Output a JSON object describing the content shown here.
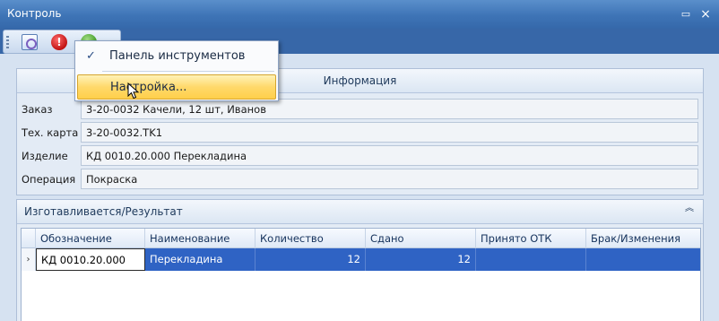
{
  "window": {
    "title": "Контроль",
    "min_glyph": "▭",
    "close_glyph": "×"
  },
  "toolbar": {
    "tools": [
      {
        "icon": "settings-icon"
      },
      {
        "icon": "stop-icon",
        "glyph": "!"
      },
      {
        "icon": "refresh-icon"
      }
    ]
  },
  "menu": {
    "items": [
      {
        "label": "Панель инструментов",
        "checked": true,
        "check_glyph": "✓"
      },
      {
        "label": "Настройка...",
        "highlighted": true
      }
    ]
  },
  "info": {
    "title": "Информация",
    "fields": [
      {
        "label": "Заказ",
        "value": "3-20-0032 Качели, 12 шт, Иванов"
      },
      {
        "label": "Тех. карта",
        "value": "3-20-0032.TK1"
      },
      {
        "label": "Изделие",
        "value": "КД 0010.20.000 Перекладина"
      },
      {
        "label": "Операция",
        "value": "Покраска"
      }
    ]
  },
  "results": {
    "title": "Изготавливается/Результат",
    "collapse_glyph": "︽",
    "columns": [
      "Обозначение",
      "Наименование",
      "Количество",
      "Сдано",
      "Принято ОТК",
      "Брак/Изменения"
    ],
    "rows": [
      {
        "indicator": "›",
        "cells": [
          "КД 0010.20.000",
          "Перекладина",
          "12",
          "12",
          "",
          ""
        ]
      }
    ]
  },
  "colors": {
    "title_bar": "#3e74b6",
    "selection": "#2f63c4",
    "menu_highlight": "#ffd96b"
  }
}
